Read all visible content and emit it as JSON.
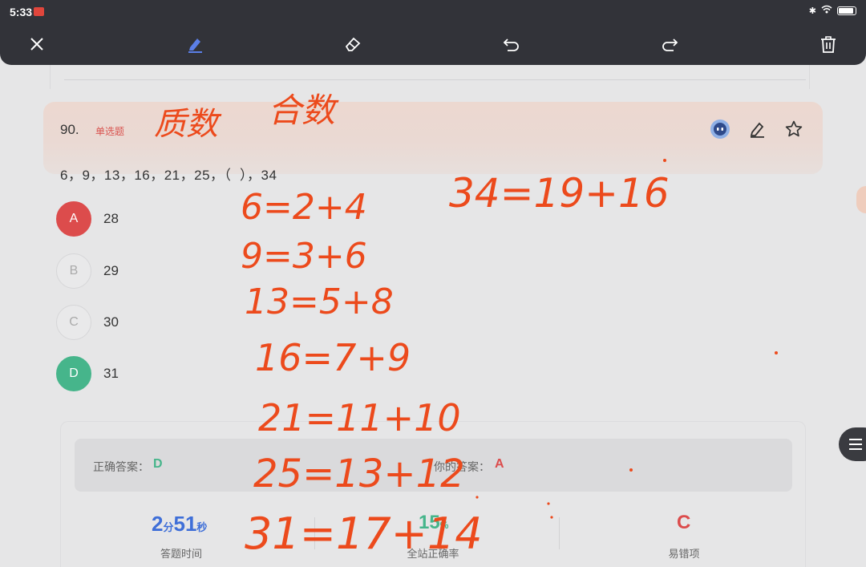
{
  "status_bar": {
    "time": "5:33"
  },
  "toolbar": {
    "tools": [
      "close-icon",
      "pen-icon",
      "eraser-icon",
      "undo-icon",
      "redo-icon",
      "trash-icon"
    ],
    "active_color": "#5b7fe8"
  },
  "question": {
    "number": "90.",
    "type": "单选题",
    "stem": "6，9，13，16，21，25，（  ），34",
    "options": [
      {
        "letter": "A",
        "value": "28",
        "state": "wrong"
      },
      {
        "letter": "B",
        "value": "29",
        "state": "none"
      },
      {
        "letter": "C",
        "value": "30",
        "state": "none"
      },
      {
        "letter": "D",
        "value": "31",
        "state": "right"
      }
    ]
  },
  "answer": {
    "correct_label": "正确答案：",
    "correct_value": "D",
    "yours_label": "你的答案：",
    "yours_value": "A"
  },
  "stats": {
    "time_min": "2",
    "time_min_unit": "分",
    "time_sec": "51",
    "time_sec_unit": "秒",
    "time_label": "答题时间",
    "accuracy": "15",
    "accuracy_unit": "%",
    "accuracy_label": "全站正确率",
    "common_wrong": "C",
    "common_wrong_label": "易错项"
  },
  "handwriting": {
    "title_left": "质数",
    "title_right": "合数",
    "right_eq": "34=19+16",
    "lines": [
      "6=2+4",
      "9=3+6",
      "13=5+8",
      "16=7+9",
      "21=11+10",
      "25=13+12",
      "31=17+14"
    ]
  },
  "colors": {
    "ink": "#ec4a1c",
    "correct": "#46b58b",
    "wrong": "#dc4c4c",
    "time": "#3f6fd8"
  }
}
